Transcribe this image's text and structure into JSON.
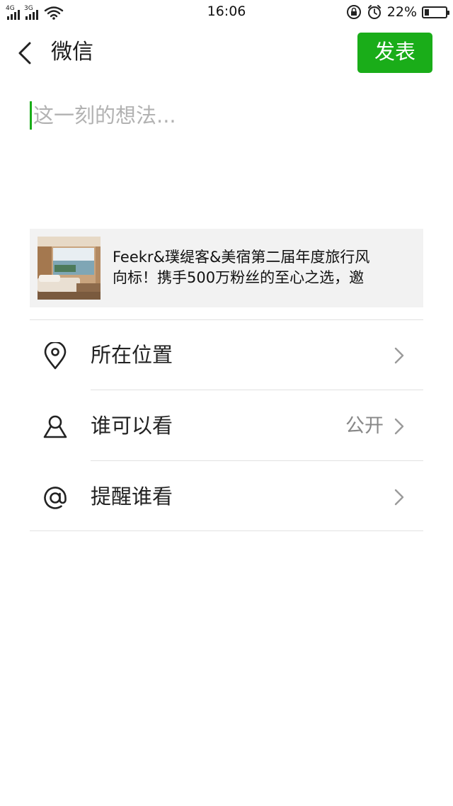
{
  "status_bar": {
    "net1_label": "4G",
    "net2_label": "3G",
    "time": "16:06",
    "battery_percent": "22%",
    "battery_level": 0.22
  },
  "header": {
    "title": "微信",
    "publish_label": "发表"
  },
  "editor": {
    "placeholder": "这一刻的想法..."
  },
  "share_card": {
    "line1": "Feekr&璞缇客&美宿第二届年度旅行风",
    "line2": "向标！携手500万粉丝的至心之选，邀"
  },
  "options": [
    {
      "label": "所在位置",
      "value": "",
      "icon": "location-pin-icon"
    },
    {
      "label": "谁可以看",
      "value": "公开",
      "icon": "person-icon"
    },
    {
      "label": "提醒谁看",
      "value": "",
      "icon": "at-icon"
    }
  ],
  "colors": {
    "accent_green": "#1aad19",
    "placeholder_gray": "#b2b2b2",
    "card_bg": "#f2f2f2"
  }
}
